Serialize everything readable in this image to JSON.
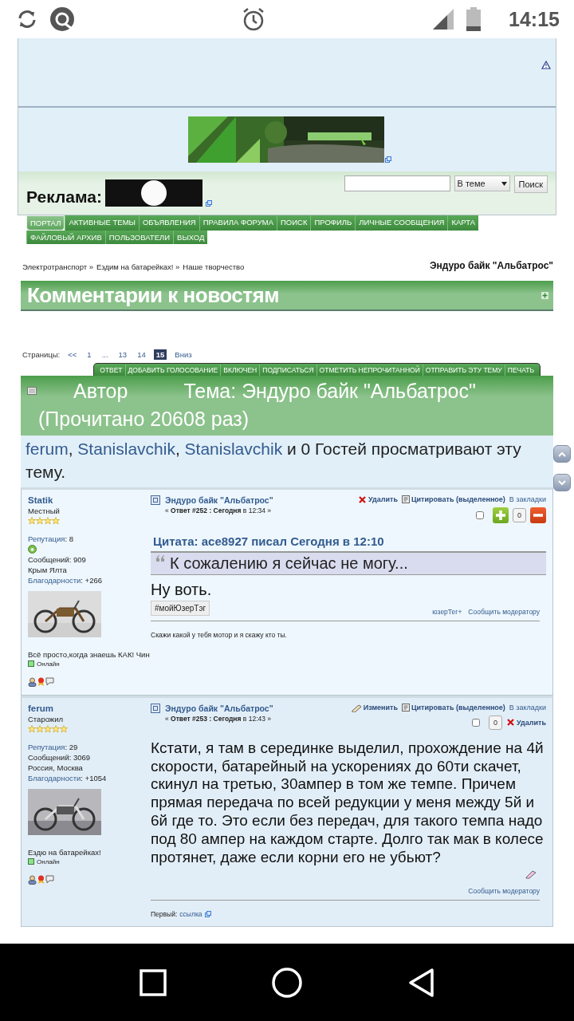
{
  "status_bar": {
    "time": "14:15"
  },
  "ad_panel": {
    "ad_label": "Реклама:",
    "search_scope": "В теме",
    "search_button": "Поиск"
  },
  "nav_menu": [
    {
      "label": "ПОРТАЛ",
      "selected": true
    },
    {
      "label": "АКТИВНЫЕ ТЕМЫ",
      "selected": false
    },
    {
      "label": "ОБЪЯВЛЕНИЯ",
      "selected": false
    },
    {
      "label": "ПРАВИЛА ФОРУМА",
      "selected": false
    },
    {
      "label": "ПОИСК",
      "selected": false
    },
    {
      "label": "ПРОФИЛЬ",
      "selected": false
    },
    {
      "label": "ЛИЧНЫЕ СООБЩЕНИЯ",
      "selected": false
    },
    {
      "label": "КАРТА",
      "selected": false
    },
    {
      "label": "ФАЙЛОВЫЙ АРХИВ",
      "selected": false
    },
    {
      "label": "ПОЛЬЗОВАТЕЛИ",
      "selected": false
    },
    {
      "label": "ВЫХОД",
      "selected": false
    }
  ],
  "breadcrumbs": [
    "Электротранспорт »",
    "Ездим на батарейках! »",
    "Наше творчество"
  ],
  "topic_title": "Эндуро байк \"Альбатрос\"",
  "board_title": "Комментарии к новостям",
  "pagination": {
    "label": "Страницы:",
    "items": [
      {
        "label": "<<",
        "selected": false
      },
      {
        "label": "1",
        "selected": false
      },
      {
        "label": "...",
        "selected": false
      },
      {
        "label": "13",
        "selected": false
      },
      {
        "label": "14",
        "selected": false
      },
      {
        "label": "15",
        "selected": true
      }
    ],
    "bottom_link": "Вниз"
  },
  "topic_buttons": [
    "ОТВЕТ",
    "ДОБАВИТЬ ГОЛОСОВАНИЕ",
    "ВКЛЮЧЕН",
    "ПОДПИСАТЬСЯ",
    "ОТМЕТИТЬ НЕПРОЧИТАННОЙ",
    "ОТПРАВИТЬ ЭТУ ТЕМУ",
    "ПЕЧАТЬ"
  ],
  "topic_header": {
    "author_label": "Автор",
    "subject": "Тема: Эндуро байк \"Альбатрос\"  (Прочитано 20608 раз)"
  },
  "viewers": {
    "names": [
      "ferum",
      "Stanislavchik",
      "Stanislavchik"
    ],
    "separator": ",",
    "rest": "и 0 Гостей просматривают эту тему."
  },
  "posts": [
    {
      "author": "Statik",
      "rank": "Местный",
      "stars": 4,
      "reputation_label": "Репутация",
      "reputation": ": 8",
      "rep_badge": true,
      "post_count": "Сообщений: 909",
      "location": "Крым Ялта",
      "thanks_label": "Благодарности",
      "thanks": ": +266",
      "photo": {
        "kind": "picture"
      },
      "signature_line": "Всё просто,когда знаешь КАК! Чин",
      "online": "Онлайн",
      "subject": "Эндуро байк \"Альбатрос\"",
      "meta": "« **Ответ #252 : Сегодня** в 12:34 »",
      "actions": [
        {
          "kind": "delete",
          "label": "Удалить"
        },
        {
          "kind": "quote",
          "label": "Цитировать (выделенное)"
        },
        {
          "kind": "bookmark",
          "label": "В закладки"
        }
      ],
      "tools": [
        {
          "kind": "checkbox",
          "checked": false
        },
        {
          "kind": "plus"
        },
        {
          "kind": "count",
          "label": "0"
        },
        {
          "kind": "minus"
        }
      ],
      "quote": {
        "header": "Цитата: ace8927 писал Сегодня в 12:10",
        "text": "К сожалению я сейчас не могу..."
      },
      "body": "Ну воть.",
      "user_tag": "#мойЮзерТэг",
      "edit_icon": false,
      "footer_links": [
        "юзерТег+",
        "Сообщить модератору"
      ],
      "after_rule": {
        "kind": "signature",
        "text": "Скажи какой у тебя мотор и я скажу кто ты."
      }
    },
    {
      "author": "ferum",
      "rank": "Старожил",
      "stars": 5,
      "reputation_label": "Репутация",
      "reputation": ": 29",
      "rep_badge": false,
      "post_count": "Сообщений: 3069",
      "location": "Россия, Москва",
      "thanks_label": "Благодарности",
      "thanks": ": +1054",
      "photo": {
        "kind": "picture"
      },
      "signature_line": "Ездю на батарейках!",
      "online": "Онлайн",
      "subject": "Эндуро байк \"Альбатрос\"",
      "meta": "« **Ответ #253 : Сегодня** в 12:43 »",
      "actions": [
        {
          "kind": "edit",
          "label": "Изменить"
        },
        {
          "kind": "quote",
          "label": "Цитировать (выделенное)"
        },
        {
          "kind": "bookmark",
          "label": "В закладки"
        }
      ],
      "tools": [
        {
          "kind": "checkbox",
          "checked": false
        },
        {
          "kind": "count",
          "label": "0"
        },
        {
          "kind": "delete",
          "label": "Удалить"
        }
      ],
      "body": "Кстати, я там в серединке выделил, прохождение на 4й скорости, батарейный на ускорениях до 60ти скачет, скинул на третью, 30ампер в том же темпе. Причем прямая передача по всей редукции у меня между 5й и 6й где то. Это если без передач, для такого темпа надо под 80 ампер на каждом старте. Долго так мак в колесе протянет, даже если корни его не убьют?",
      "edit_icon": true,
      "footer_links": [
        "Сообщить модератору"
      ],
      "after_rule": {
        "kind": "link",
        "label": "Первый:",
        "link": "ссылка"
      }
    }
  ]
}
